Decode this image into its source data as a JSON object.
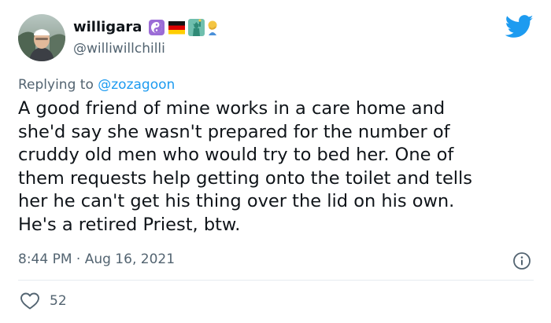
{
  "tweet": {
    "display_name": "willigara",
    "handle": "@williwillchilli",
    "replying_prefix": "Replying to ",
    "replying_to": "@zozagoon",
    "text": "A good friend of mine works in a care home and\nshe'd say she wasn't prepared for the number of\ncruddy old men who would try to bed her. One of\nthem requests help getting onto the toilet and tells\nher he can't get his thing over the lid on his own.\nHe's a retired Priest, btw.",
    "timestamp": "8:44 PM · Aug 16, 2021",
    "like_count": "52"
  },
  "name_emojis": [
    "yin-yang-icon",
    "german-flag-icon",
    "statue-of-liberty-icon",
    "person-facepalming-icon"
  ],
  "colors": {
    "brand": "#1d9bf0",
    "secondary_text": "#536471",
    "primary_text": "#0f1419",
    "divider": "#e6ecf0"
  }
}
